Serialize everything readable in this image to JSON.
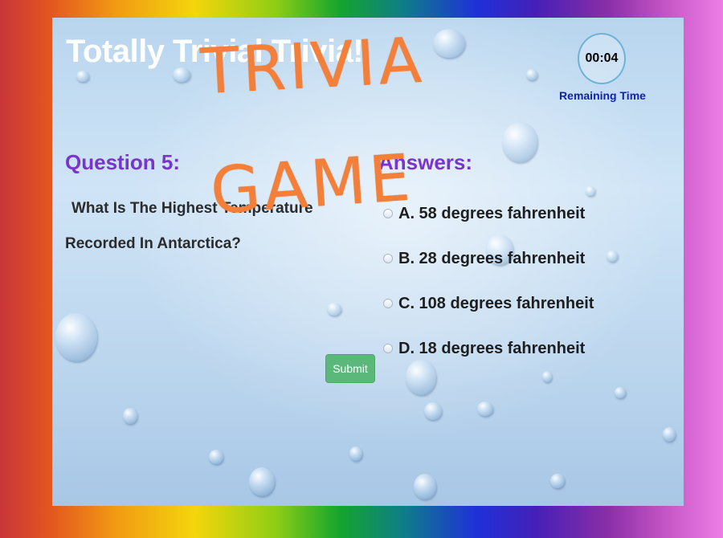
{
  "window": {
    "title": "Totally Trivial Trivia!"
  },
  "timer": {
    "value": "00:04",
    "label": "Remaining Time"
  },
  "question": {
    "heading": "Question 5:",
    "text": "What Is The Highest Temperature Recorded In Antarctica?"
  },
  "answers": {
    "heading": "Answers:",
    "options": [
      {
        "label": "A. 58 degrees fahrenheit",
        "selected": false
      },
      {
        "label": "B. 28 degrees fahrenheit",
        "selected": false
      },
      {
        "label": "C. 108 degrees fahrenheit",
        "selected": false
      },
      {
        "label": "D. 18 degrees fahrenheit",
        "selected": false
      }
    ]
  },
  "submit_label": "Submit",
  "overlay": {
    "line1": "TRIVIA",
    "line2": "GAME"
  },
  "colors": {
    "heading": "#7a33cc",
    "timer_label": "#1020b8",
    "submit": "#5cb87a",
    "overlay": "#f2803a"
  }
}
